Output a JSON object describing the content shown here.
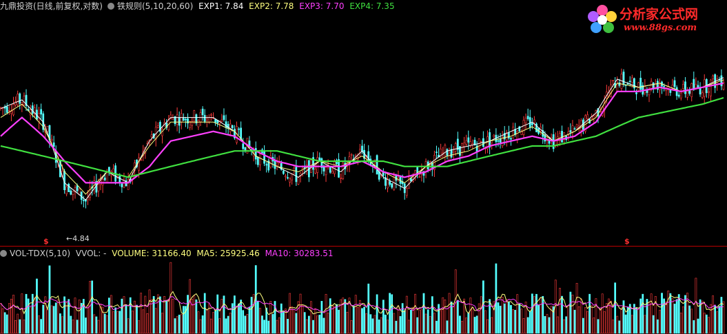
{
  "price_header": {
    "title": "九鼎投资(日线,前复权,对数)",
    "indicator": "铁规则(5,10,20,60)",
    "exp1": "EXP1: 7.84",
    "exp2": "EXP2: 7.78",
    "exp3": "EXP3: 7.70",
    "exp4": "EXP4: 7.35"
  },
  "volume_header": {
    "indicator": "VOL-TDX(5,10)",
    "vvol": "VVOL: -",
    "volume": "VOLUME: 31166.40",
    "ma5": "MA5: 25925.46",
    "ma10": "MA10: 30283.51"
  },
  "low_label": "←4.84",
  "signal_marks": [
    "$",
    "$"
  ],
  "logo": {
    "name": "分析家公式网",
    "url": "www.88gs.com"
  },
  "colors": {
    "up": "#ff3c3c",
    "down": "#54ffff",
    "exp1": "#ffffff",
    "exp2": "#ffff80",
    "exp3": "#ff40ff",
    "exp4": "#40e040",
    "divider": "#b00000"
  },
  "chart_data": [
    {
      "type": "line",
      "log_scale": true,
      "x": [
        0,
        10,
        20,
        30,
        40,
        50,
        60,
        70,
        80,
        90,
        100,
        110,
        120,
        130,
        140,
        150,
        160,
        170,
        180,
        190,
        200,
        210,
        220,
        230,
        240,
        250,
        260,
        270,
        280,
        290,
        300,
        310,
        320,
        330,
        340
      ],
      "series": [
        {
          "name": "EXP1",
          "values": [
            7.1,
            7.3,
            6.8,
            5.6,
            5.3,
            5.8,
            5.6,
            6.4,
            6.9,
            6.9,
            6.9,
            6.6,
            6.1,
            5.9,
            5.7,
            6.0,
            5.8,
            6.2,
            5.7,
            5.5,
            5.9,
            6.2,
            6.3,
            6.4,
            6.6,
            6.8,
            6.4,
            6.6,
            7.0,
            7.8,
            7.6,
            7.7,
            7.5,
            7.6,
            7.84
          ]
        },
        {
          "name": "EXP2",
          "values": [
            6.9,
            7.2,
            6.7,
            5.8,
            5.4,
            5.8,
            5.7,
            6.3,
            6.8,
            6.8,
            6.8,
            6.6,
            6.1,
            5.9,
            5.8,
            6.0,
            5.9,
            6.1,
            5.8,
            5.6,
            5.9,
            6.1,
            6.2,
            6.4,
            6.5,
            6.7,
            6.4,
            6.6,
            6.9,
            7.7,
            7.6,
            7.7,
            7.5,
            7.6,
            7.78
          ]
        },
        {
          "name": "EXP3",
          "values": [
            6.5,
            6.9,
            6.5,
            6.0,
            5.6,
            5.6,
            5.6,
            5.9,
            6.4,
            6.5,
            6.6,
            6.5,
            6.2,
            6.0,
            5.9,
            5.9,
            5.9,
            6.0,
            5.8,
            5.7,
            5.8,
            6.0,
            6.1,
            6.3,
            6.4,
            6.5,
            6.4,
            6.5,
            6.8,
            7.5,
            7.5,
            7.6,
            7.5,
            7.6,
            7.7
          ]
        },
        {
          "name": "EXP4",
          "values": [
            6.3,
            6.2,
            6.1,
            6.0,
            5.9,
            5.8,
            5.7,
            5.8,
            5.9,
            6.0,
            6.1,
            6.2,
            6.2,
            6.2,
            6.1,
            6.0,
            6.0,
            6.0,
            6.0,
            5.9,
            5.9,
            5.9,
            6.0,
            6.1,
            6.2,
            6.3,
            6.3,
            6.4,
            6.5,
            6.7,
            6.9,
            7.0,
            7.1,
            7.2,
            7.35
          ]
        }
      ],
      "low_annotation": 4.84
    },
    {
      "type": "bar",
      "volume_last": 31166.4,
      "ma5_last": 25925.46,
      "ma10_last": 30283.51
    }
  ]
}
